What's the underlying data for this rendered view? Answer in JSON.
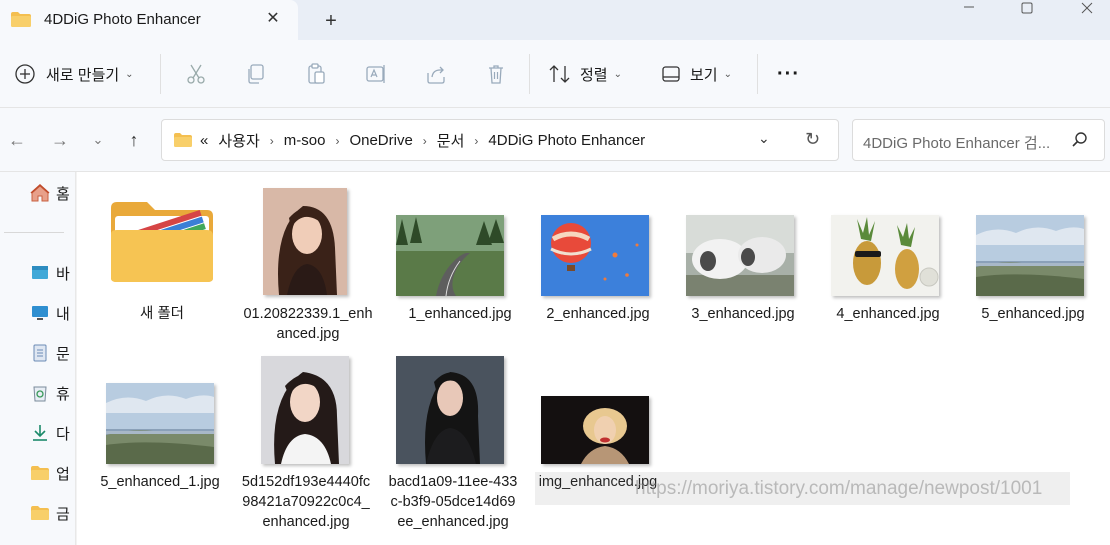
{
  "window": {
    "tab_title": "4DDiG Photo Enhancer",
    "close_tab": "✕",
    "new_tab": "+"
  },
  "toolbar": {
    "new_label": "새로 만들기",
    "sort_label": "정렬",
    "view_label": "보기",
    "more_label": "···"
  },
  "address": {
    "overflow": "«",
    "crumbs": [
      "사용자",
      "m-soo",
      "OneDrive",
      "문서",
      "4DDiG Photo Enhancer"
    ],
    "search_placeholder": "4DDiG Photo Enhancer 검..."
  },
  "sidebar": {
    "items": [
      "홈",
      "바",
      "내",
      "문",
      "휴",
      "다",
      "업",
      "금"
    ]
  },
  "files": [
    {
      "name": "새 폴더",
      "type": "folder"
    },
    {
      "name": "01.20822339.1_enhanced.jpg",
      "type": "portrait"
    },
    {
      "name": "1_enhanced.jpg",
      "type": "forest"
    },
    {
      "name": "2_enhanced.jpg",
      "type": "balloon"
    },
    {
      "name": "3_enhanced.jpg",
      "type": "pods"
    },
    {
      "name": "4_enhanced.jpg",
      "type": "pineapple"
    },
    {
      "name": "5_enhanced.jpg",
      "type": "landscape"
    },
    {
      "name": "5_enhanced_1.jpg",
      "type": "landscape"
    },
    {
      "name": "5d152df193e4440fc98421a70922c0c4_enhanced.jpg",
      "type": "portrait2"
    },
    {
      "name": "bacd1a09-11ee-433c-b3f9-05dce14d69ee_enhanced.jpg",
      "type": "portrait3"
    },
    {
      "name": "img_enhanced.jpg",
      "type": "dark"
    }
  ],
  "watermark": "https://moriya.tistory.com/manage/newpost/1001",
  "colors": {
    "accent": "#0067c0",
    "folder": "#f4bf50",
    "background": "#f3f3f3"
  }
}
